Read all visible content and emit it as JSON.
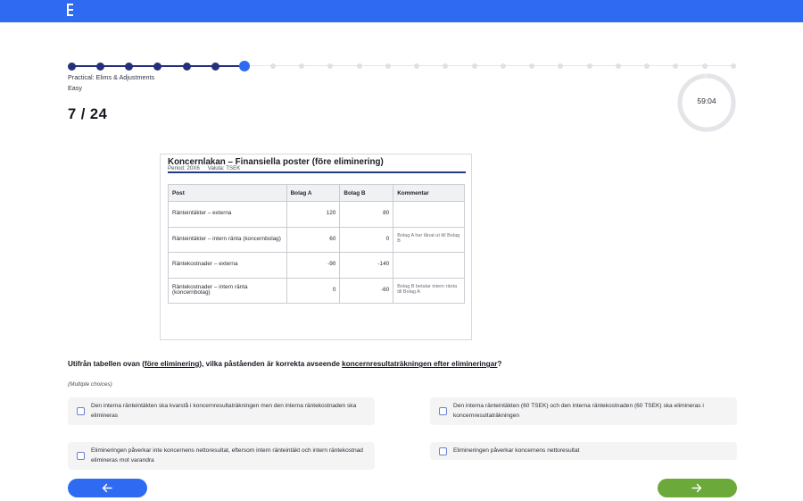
{
  "header": {
    "logo_icon": "brand-logo-icon",
    "bar_color": "#2f6bf2"
  },
  "progress": {
    "total_steps": 24,
    "current_step": 7,
    "done_color": "#24307a",
    "current_color": "#2f6bf2",
    "todo_color": "#dfe1e5"
  },
  "quiz": {
    "category": "Practical: Elims & Adjustments",
    "difficulty": "Easy",
    "counter": "7 / 24"
  },
  "timer": {
    "value": "59:04",
    "remaining_fraction": 0.985
  },
  "document": {
    "title": "Koncernlakan – Finansiella poster (före eliminering)",
    "period": "Period: 20X6",
    "currency": "Valuta: TSEK",
    "columns": [
      "Post",
      "Bolag A",
      "Bolag B",
      "Kommentar"
    ],
    "rows": [
      {
        "post": "Ränteintäkter – externa",
        "a": "120",
        "b": "80",
        "comment": ""
      },
      {
        "post": "Ränteintäkter – intern ränta (koncernbolag)",
        "a": "60",
        "b": "0",
        "comment": "Bolag A har lånat ut till Bolag B"
      },
      {
        "post": "Räntekostnader – externa",
        "a": "-90",
        "b": "-140",
        "comment": ""
      },
      {
        "post": "Räntekostnader – intern ränta (koncernbolag)",
        "a": "0",
        "b": "-60",
        "comment": "Bolag B betalar intern ränta till Bolag A"
      }
    ]
  },
  "question": {
    "part1": "Utifrån tabellen ovan (",
    "u1": "före eliminering",
    "part2": "), vilka påståenden är korrekta avseende ",
    "u2": "koncernresultaträkningen efter elimineringar",
    "part3": "?",
    "hint": "(Multiple choices)"
  },
  "options": [
    {
      "label": "Den interna ränteintäkten ska kvarstå i koncernresultaträkningen men den interna räntekostnaden ska elimineras",
      "checked": false
    },
    {
      "label": "Den interna ränteintäkten (60 TSEK) och den interna räntekostnaden (60 TSEK) ska elimineras i koncernresultaträkningen",
      "checked": false
    },
    {
      "label": "Elimineringen påverkar inte koncernens nettoresultat, eftersom intern ränteintäkt och intern räntekostnad elimineras mot varandra",
      "checked": false
    },
    {
      "label": "Elimineringen påverkar koncernens nettoresultat",
      "checked": false
    }
  ],
  "nav": {
    "back_icon": "arrow-left-icon",
    "next_icon": "arrow-right-icon",
    "back_color": "#2f6bf2",
    "next_color": "#6aa93a"
  }
}
